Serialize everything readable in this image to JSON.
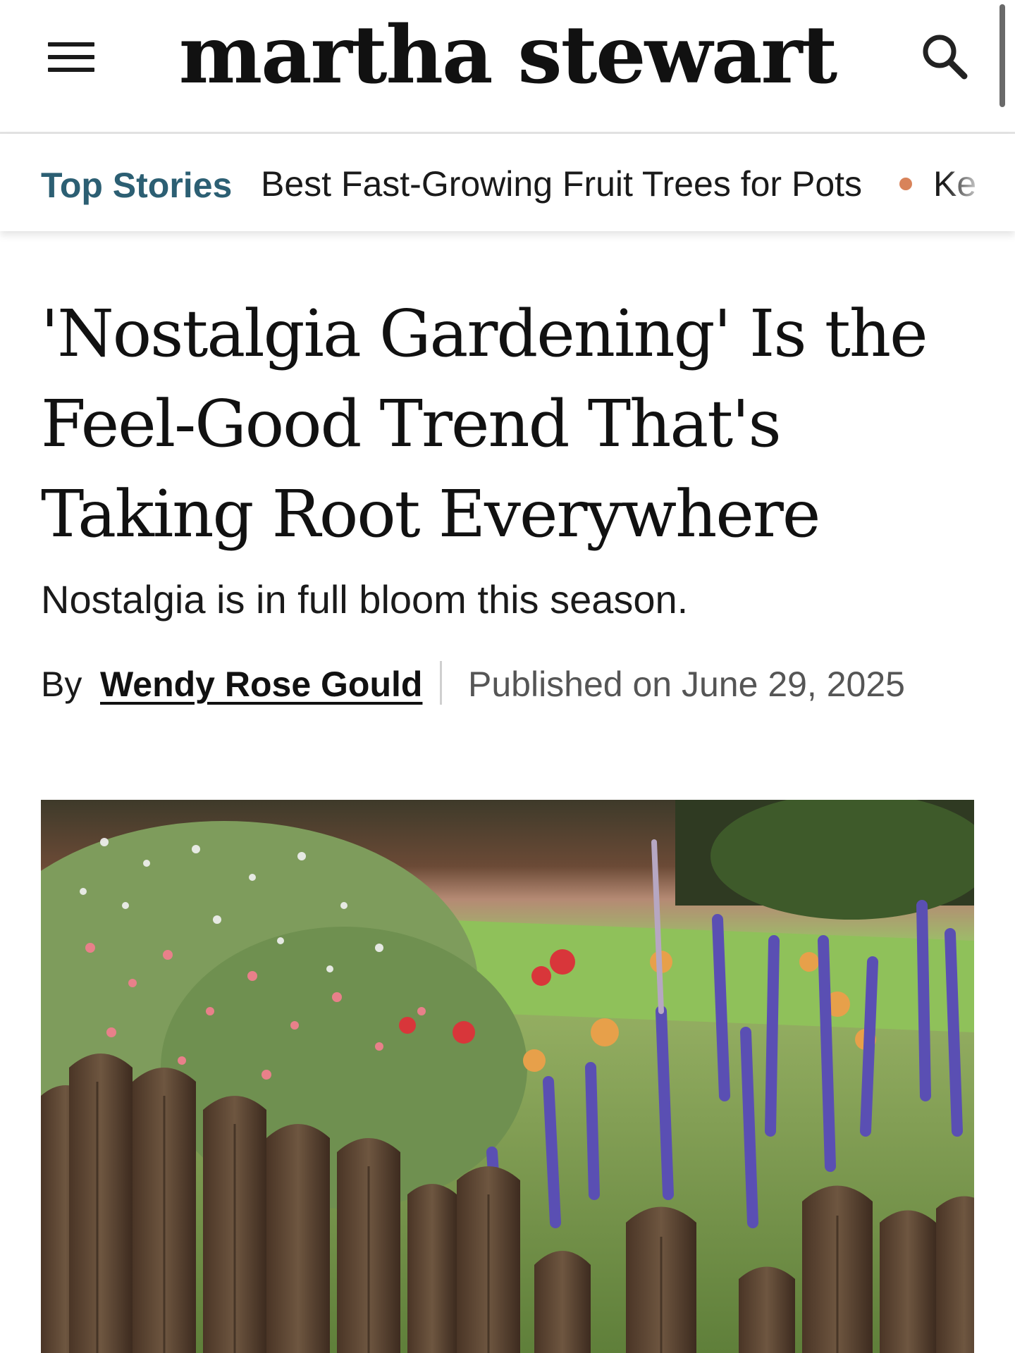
{
  "header": {
    "logo": "martha stewart",
    "menu_icon": "hamburger-menu-icon",
    "search_icon": "search-icon"
  },
  "top_stories": {
    "label": "Top Stories",
    "items": [
      "Best Fast-Growing Fruit Trees for Pots",
      "Ke"
    ],
    "accent_color": "#2c5f73",
    "dot_color": "#d8835a"
  },
  "article": {
    "headline": "'Nostalgia Gardening' Is the Feel-Good Trend That's Taking Root Everywhere",
    "subhead": "Nostalgia is in full bloom this season.",
    "byline_prefix": "By",
    "author": "Wendy Rose Gould",
    "published": "Published on June 29, 2025"
  },
  "hero_image": {
    "description_icon": "garden-photo"
  }
}
